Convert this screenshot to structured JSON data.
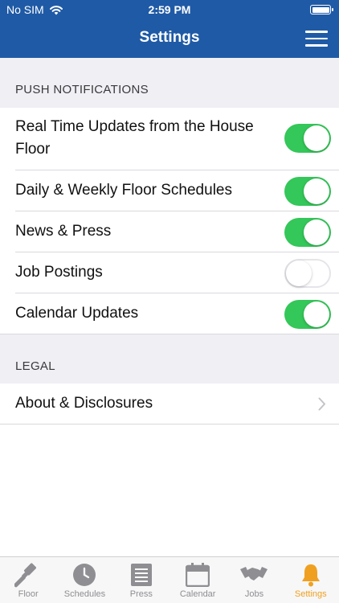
{
  "status_bar": {
    "carrier": "No SIM",
    "time": "2:59 PM"
  },
  "nav": {
    "title": "Settings"
  },
  "sections": {
    "push": {
      "header": "PUSH NOTIFICATIONS",
      "items": [
        {
          "label_line1": "Real Time Updates from the House",
          "label_line2": "Floor",
          "on": true
        },
        {
          "label": "Daily & Weekly Floor Schedules",
          "on": true
        },
        {
          "label": "News & Press",
          "on": true
        },
        {
          "label": "Job Postings",
          "on": false
        },
        {
          "label": "Calendar Updates",
          "on": true
        }
      ]
    },
    "legal": {
      "header": "LEGAL",
      "items": [
        {
          "label": "About & Disclosures"
        }
      ]
    }
  },
  "tabs": [
    {
      "label": "Floor",
      "icon": "gavel-icon"
    },
    {
      "label": "Schedules",
      "icon": "clock-icon"
    },
    {
      "label": "Press",
      "icon": "newspaper-icon"
    },
    {
      "label": "Calendar",
      "icon": "calendar-icon"
    },
    {
      "label": "Jobs",
      "icon": "handshake-icon"
    },
    {
      "label": "Settings",
      "icon": "bell-icon",
      "active": true
    }
  ],
  "colors": {
    "nav_blue": "#1f5aa6",
    "toggle_on": "#34c759",
    "tab_active": "#f0a020",
    "tab_inactive": "#8e8e93"
  }
}
